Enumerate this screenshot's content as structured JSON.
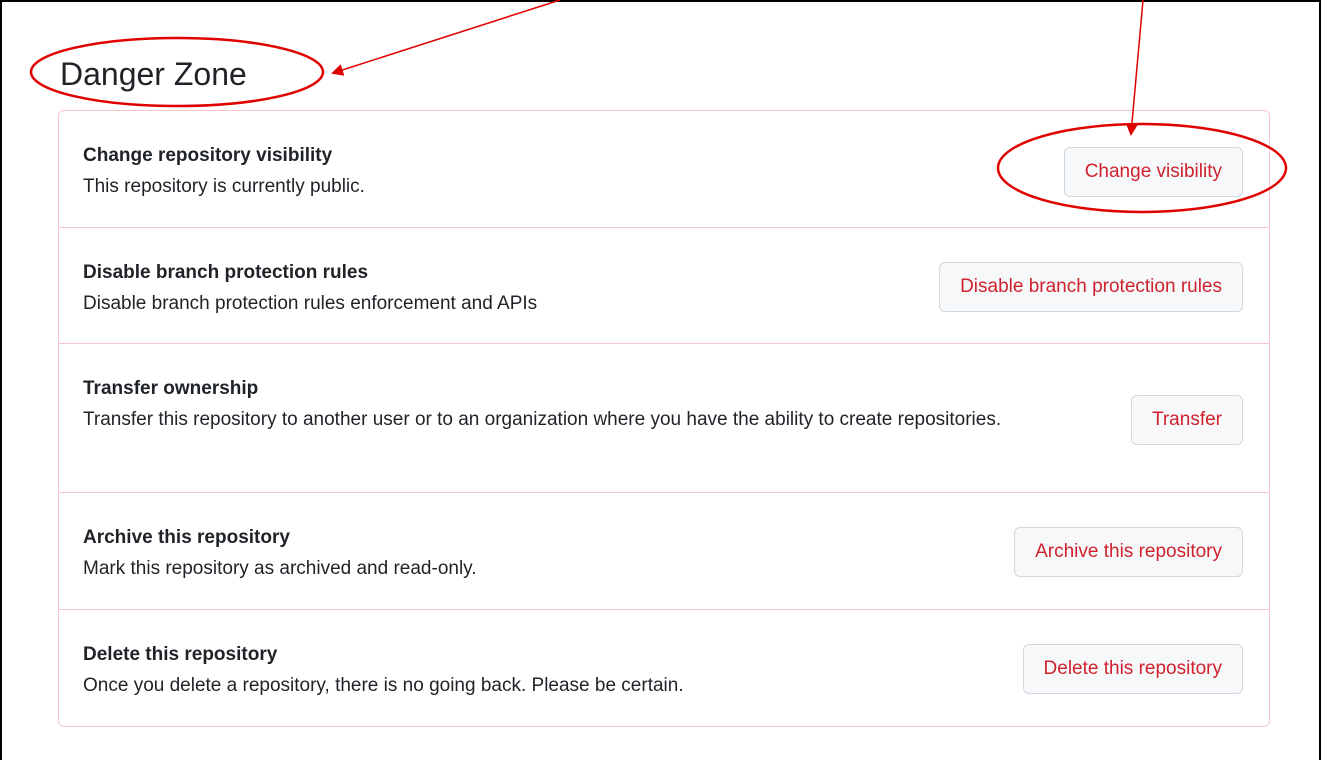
{
  "title": "Danger Zone",
  "annotation_color": "#e00000",
  "danger_color": "#cf222e",
  "rows": [
    {
      "title": "Change repository visibility",
      "description": "This repository is currently public.",
      "button": "Change visibility",
      "highlighted": true
    },
    {
      "title": "Disable branch protection rules",
      "description": "Disable branch protection rules enforcement and APIs",
      "button": "Disable branch protection rules",
      "highlighted": false
    },
    {
      "title": "Transfer ownership",
      "description": "Transfer this repository to another user or to an organization where you have the ability to create repositories.",
      "button": "Transfer",
      "highlighted": false
    },
    {
      "title": "Archive this repository",
      "description": "Mark this repository as archived and read-only.",
      "button": "Archive this repository",
      "highlighted": false
    },
    {
      "title": "Delete this repository",
      "description": "Once you delete a repository, there is no going back. Please be certain.",
      "button": "Delete this repository",
      "highlighted": false
    }
  ]
}
